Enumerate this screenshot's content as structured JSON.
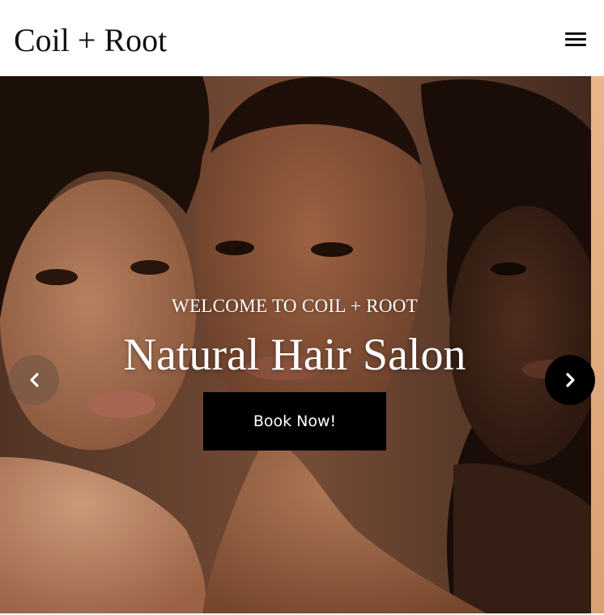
{
  "header": {
    "logo": "Coil + Root",
    "menu_icon": "hamburger-menu-icon"
  },
  "hero": {
    "kicker": "WELCOME TO COIL + ROOT",
    "headline": "Natural Hair Salon",
    "cta_label": "Book Now!",
    "prev_icon": "chevron-left-icon",
    "next_icon": "chevron-right-icon"
  },
  "colors": {
    "page_background": "#ffffff",
    "text_dark": "#111111",
    "cta_background": "#000000",
    "cta_text": "#ffffff",
    "hero_text": "#ffffff"
  }
}
